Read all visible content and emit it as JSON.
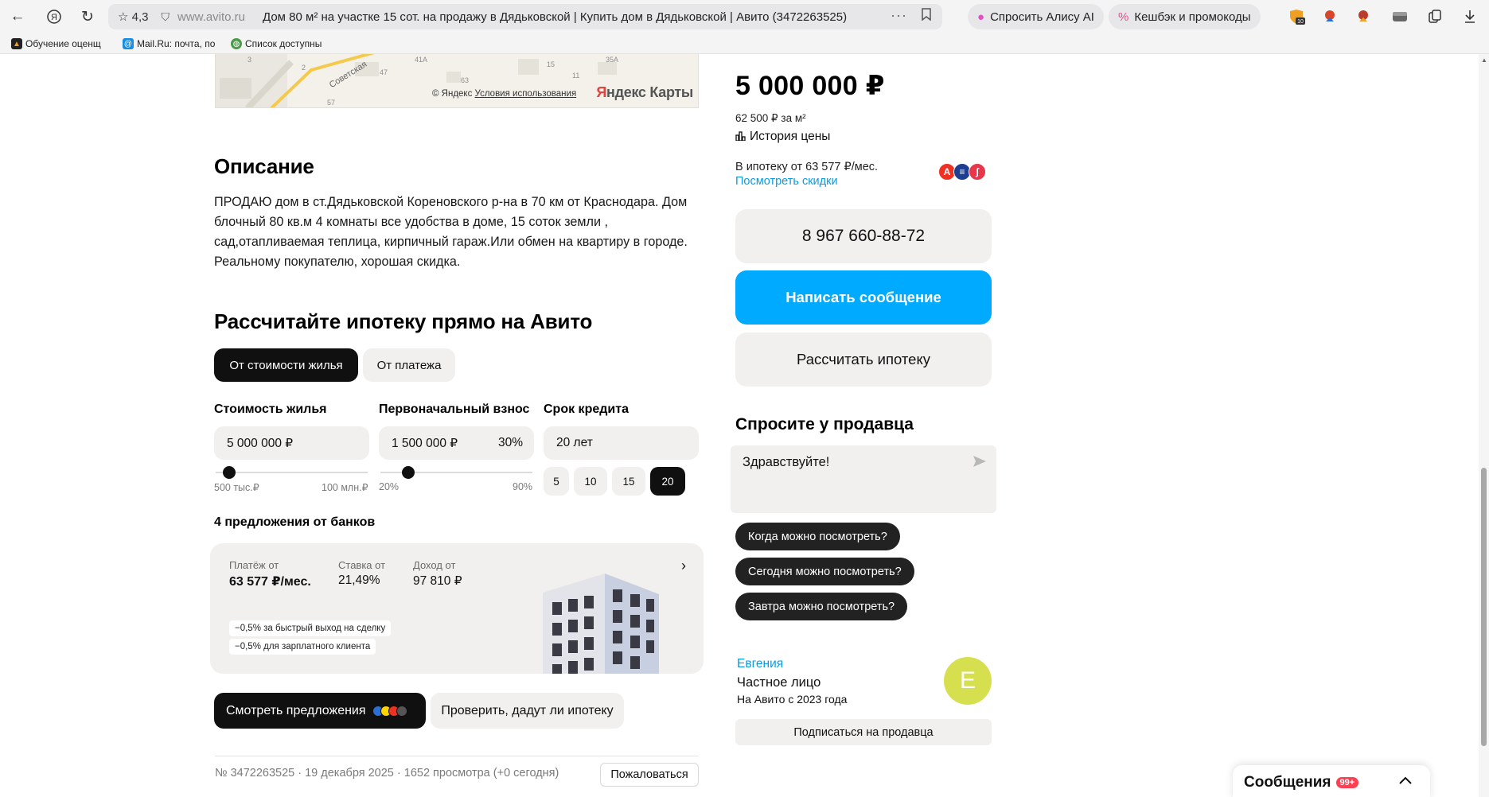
{
  "browser": {
    "rating": "4,3",
    "domain": "www.avito.ru",
    "page_title": "Дом 80 м² на участке 15 сот. на продажу в Дядьковской | Купить дом в Дядьковской | Авито (3472263525)",
    "alice_label": "Спросить Алису AI",
    "cashback_label": "Кешбэк и промокоды",
    "ext_badge": "10",
    "bookmarks": [
      "Обучение оценщ",
      "Mail.Ru: почта, по",
      "Список доступны"
    ]
  },
  "map": {
    "copyright": "© Яндекс",
    "terms": "Условия использования",
    "logo_red": "Я",
    "logo_rest": "ндекс Карты",
    "street": "Советская",
    "numbers": [
      "3",
      "2",
      "47",
      "41А",
      "63",
      "15",
      "11",
      "35А",
      "57"
    ]
  },
  "description": {
    "title": "Описание",
    "text": "ПРОДАЮ дом в ст.Дядьковской Кореновского р-на в 70 км от Краснодара. Дом блочный 80 кв.м 4 комнаты все удобства в доме, 15 соток земли , сад,отапливаемая теплица, кирпичный гараж.Или обмен на квартиру в городе. Реальному покупателю, хорошая скидка."
  },
  "mortgage": {
    "title": "Рассчитайте ипотеку прямо на Авито",
    "tab_active": "От стоимости жилья",
    "tab_inactive": "От платежа",
    "cost_label": "Стоимость жилья",
    "cost_value": "5 000 000 ₽",
    "cost_min": "500 тыс.₽",
    "cost_max": "100 млн.₽",
    "cost_slider_fraction": 0.045,
    "down_label": "Первоначальный взнос",
    "down_value": "1 500 000 ₽",
    "down_pct": "30%",
    "down_min": "20%",
    "down_max": "90%",
    "down_slider_fraction": 0.143,
    "term_label": "Срок кредита",
    "term_value": "20 лет",
    "term_options": [
      "5",
      "10",
      "15",
      "20"
    ],
    "term_selected": "20",
    "offers_title": "4 предложения от банков",
    "payment_label": "Платёж от",
    "payment_value": "63 577 ₽/мес.",
    "rate_label": "Ставка от",
    "rate_value": "21,49%",
    "income_label": "Доход от",
    "income_value": "97 810 ₽",
    "tags": [
      "−0,5% за быстрый выход на сделку",
      "−0,5% для зарплатного клиента"
    ],
    "view_offers": "Смотреть предложения",
    "check": "Проверить, дадут ли ипотеку"
  },
  "listing_meta": {
    "info": "№ 3472263525 · 19 декабря 2025 · 1652 просмотра (+0 сегодня)",
    "report": "Пожаловаться"
  },
  "sidebar": {
    "price": "5 000 000 ₽",
    "per_m2": "62 500 ₽ за м²",
    "history": "История цены",
    "mortgage_from": "В ипотеку от 63 577 ₽/мес.",
    "discount_link": "Посмотреть скидки",
    "phone": "8 967 660-88-72",
    "write": "Написать сообщение",
    "calc": "Рассчитать ипотеку",
    "ask_title": "Спросите у продавца",
    "message_text": "Здравствуйте!",
    "quick_questions": [
      "Когда можно посмотреть?",
      "Сегодня можно посмотреть?",
      "Завтра можно посмотреть?"
    ],
    "seller_name": "Евгения",
    "seller_type": "Частное лицо",
    "seller_since": "На Авито с 2023 года",
    "avatar_letter": "Е",
    "subscribe": "Подписаться на продавца"
  },
  "messenger": {
    "title": "Сообщения",
    "badge": "99+"
  },
  "colors": {
    "accent": "#00aaff",
    "dark": "#101010",
    "link": "#0a9be0",
    "avatar": "#d6e04f"
  }
}
